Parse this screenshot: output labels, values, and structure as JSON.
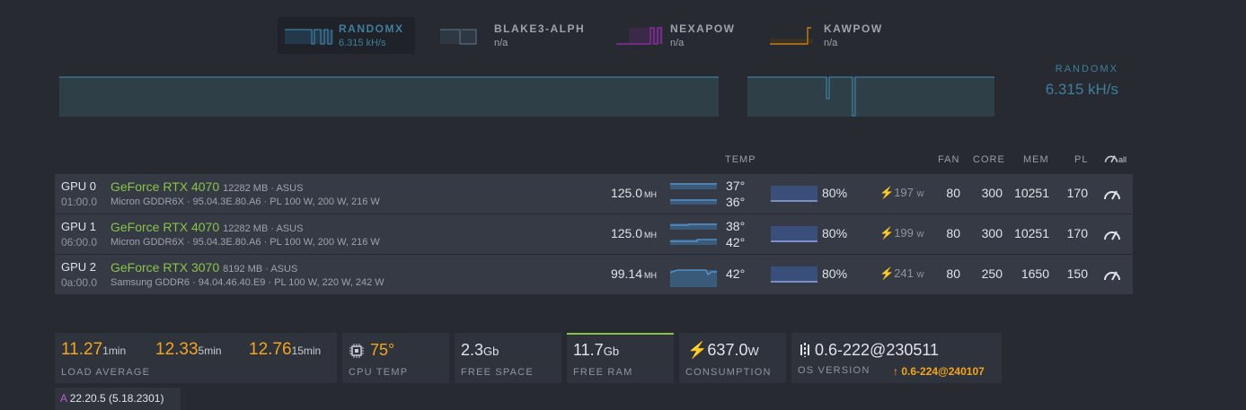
{
  "algos": [
    {
      "name": "RANDOMX",
      "rate": "6.315 kH/s",
      "color": "#3f7f9d",
      "active": true
    },
    {
      "name": "BLAKE3-ALPH",
      "rate": "n/a",
      "color": "#5a6b7e",
      "active": false
    },
    {
      "name": "NEXAPOW",
      "rate": "n/a",
      "color": "#8a2d9e",
      "active": false
    },
    {
      "name": "KAWPOW",
      "rate": "n/a",
      "color": "#c77a18",
      "active": false
    }
  ],
  "hashrate": {
    "title": "RANDOMX",
    "value": "6.315 kH/s"
  },
  "columns": {
    "temp": "TEMP",
    "fan": "FAN",
    "core": "CORE",
    "mem": "MEM",
    "pl": "PL",
    "all": "all"
  },
  "gpus": [
    {
      "id": "GPU 0",
      "bus": "01:00.0",
      "model": "GeForce RTX 4070",
      "extra": "12282 MB · ASUS",
      "memory": "Micron GDDR6X · 95.04.3E.80.A6 · PL 100 W, 200 W, 216 W",
      "hash": "125.0",
      "hash_unit": "MH",
      "temp1": "37°",
      "temp2": "36°",
      "fan_pct": "80%",
      "power": "197",
      "power_unit": "w",
      "fan": "80",
      "core": "300",
      "mem": "10251",
      "pl": "170"
    },
    {
      "id": "GPU 1",
      "bus": "06:00.0",
      "model": "GeForce RTX 4070",
      "extra": "12282 MB · ASUS",
      "memory": "Micron GDDR6X · 95.04.3E.80.A6 · PL 100 W, 200 W, 216 W",
      "hash": "125.0",
      "hash_unit": "MH",
      "temp1": "38°",
      "temp2": "42°",
      "fan_pct": "80%",
      "power": "199",
      "power_unit": "w",
      "fan": "80",
      "core": "300",
      "mem": "10251",
      "pl": "170"
    },
    {
      "id": "GPU 2",
      "bus": "0a:00.0",
      "model": "GeForce RTX 3070",
      "extra": "8192 MB · ASUS",
      "memory": "Samsung GDDR6 · 94.04.46.40.E9 · PL 100 W, 220 W, 242 W",
      "hash": "99.14",
      "hash_unit": "MH",
      "temp1": "42°",
      "temp2": "",
      "fan_pct": "80%",
      "power": "241",
      "power_unit": "w",
      "fan": "80",
      "core": "250",
      "mem": "1650",
      "pl": "150"
    }
  ],
  "stats": {
    "load": {
      "v1": "11.27",
      "u1": "1min",
      "v5": "12.33",
      "u5": "5min",
      "v15": "12.76",
      "u15": "15min",
      "label": "LOAD AVERAGE"
    },
    "cpu_temp": {
      "value": "75°",
      "label": "CPU TEMP"
    },
    "free_space": {
      "value": "2.3",
      "unit": "Gb",
      "label": "FREE SPACE"
    },
    "free_ram": {
      "value": "11.7",
      "unit": "Gb",
      "label": "FREE RAM"
    },
    "consumption": {
      "value": "637.0",
      "unit": "W",
      "label": "CONSUMPTION"
    },
    "os": {
      "value": "0.6-222@230511",
      "label": "OS VERSION",
      "update": "0.6-224@240107"
    }
  },
  "versions": {
    "a_prefix": "A",
    "a_value": "22.20.5 (5.18.2301)"
  }
}
